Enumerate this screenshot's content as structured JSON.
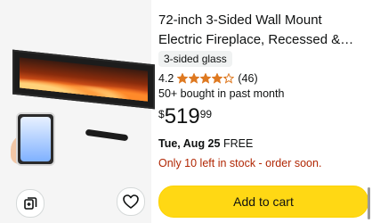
{
  "product": {
    "title": "72-inch 3-Sided Wall Mount Electric Fireplace, Recessed &…",
    "variant_badge": "3-sided glass",
    "rating_value": "4.2",
    "rating_stars": 4.2,
    "reviews_count": "(46)",
    "bought_text": "50+ bought in past month",
    "price": {
      "currency": "$",
      "whole": "519",
      "fraction": "99"
    },
    "delivery": {
      "date": "Tue, Aug 25",
      "label": "FREE"
    },
    "stock_text": "Only 10 left in stock - order soon.",
    "add_to_cart_label": "Add to cart"
  },
  "icons": {
    "compare": "compare-icon",
    "favorite": "heart-outline-icon",
    "star": "star-icon"
  },
  "colors": {
    "accent_button": "#ffd814",
    "stock_red": "#b12704",
    "star_orange": "#de7921",
    "badge_bg": "#f0f2f2"
  }
}
